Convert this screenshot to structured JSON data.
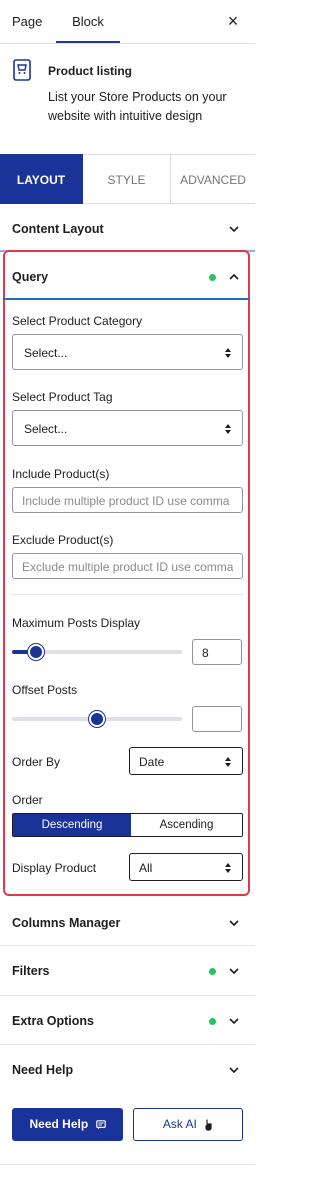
{
  "top_tabs": {
    "page": "Page",
    "block": "Block",
    "close": "×"
  },
  "block": {
    "title": "Product listing",
    "description": "List your Store Products on your website with intuitive design"
  },
  "main_tabs": {
    "layout": "LAYOUT",
    "style": "STYLE",
    "advanced": "ADVANCED"
  },
  "panels": {
    "content_layout": "Content Layout",
    "query": "Query",
    "columns_manager": "Columns Manager",
    "filters": "Filters",
    "extra_options": "Extra Options",
    "need_help": "Need Help"
  },
  "query": {
    "category_label": "Select Product Category",
    "category_value": "Select...",
    "tag_label": "Select Product Tag",
    "tag_value": "Select...",
    "include_label": "Include Product(s)",
    "include_placeholder": "Include multiple product ID use comma",
    "exclude_label": "Exclude Product(s)",
    "exclude_placeholder": "Exclude multiple product ID use comma",
    "max_posts_label": "Maximum Posts Display",
    "max_posts_value": "8",
    "max_posts_fraction": 0.14,
    "offset_label": "Offset Posts",
    "offset_value": "",
    "offset_fraction": 0.5,
    "order_by_label": "Order By",
    "order_by_value": "Date",
    "order_label": "Order",
    "order_desc": "Descending",
    "order_asc": "Ascending",
    "display_label": "Display Product",
    "display_value": "All"
  },
  "actions": {
    "need_help": "Need Help",
    "ask_ai": "Ask AI"
  },
  "colors": {
    "primary": "#1a3399",
    "highlight": "#e0374a",
    "status_dot": "#22c55e"
  }
}
